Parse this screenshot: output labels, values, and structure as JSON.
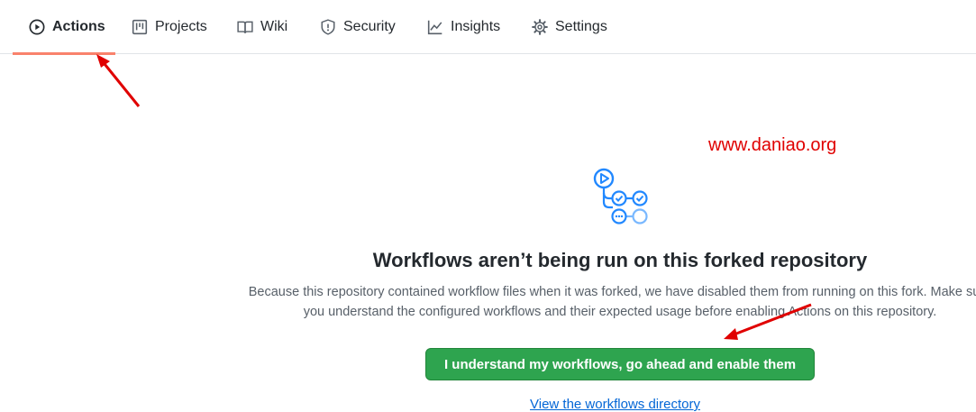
{
  "tabs": [
    {
      "label": "Actions",
      "icon": "play-icon",
      "active": true
    },
    {
      "label": "Projects",
      "icon": "project-board-icon",
      "active": false
    },
    {
      "label": "Wiki",
      "icon": "book-icon",
      "active": false
    },
    {
      "label": "Security",
      "icon": "shield-icon",
      "active": false
    },
    {
      "label": "Insights",
      "icon": "graph-icon",
      "active": false
    },
    {
      "label": "Settings",
      "icon": "gear-icon",
      "active": false
    }
  ],
  "watermark": "www.daniao.org",
  "main": {
    "headline": "Workflows aren’t being run on this forked repository",
    "description_line1": "Because this repository contained workflow files when it was forked, we have disabled them from running on this fork. Make sure",
    "description_line2": "you understand the configured workflows and their expected usage before enabling Actions on this repository.",
    "enable_button": "I understand my workflows, go ahead and enable them",
    "directory_link": "View the workflows directory"
  },
  "colors": {
    "accent_underline": "#f9826c",
    "button_green": "#2ea44f",
    "link_blue": "#0366d6",
    "annotation_red": "#e00000",
    "hero_icon_blue": "#2188ff"
  }
}
